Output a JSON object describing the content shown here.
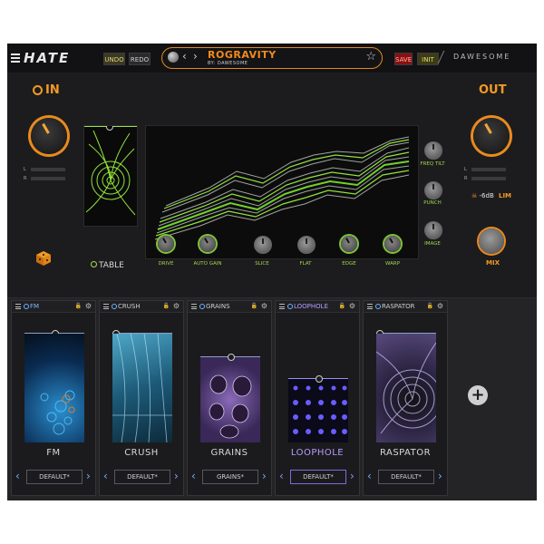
{
  "header": {
    "logo": "HATE",
    "undo": "UNDO",
    "redo": "REDO",
    "preset_name": "ROGRAVITY",
    "preset_author": "BY: DAWESOME",
    "save": "SAVE",
    "init": "INIT",
    "brand": "DAWESOME"
  },
  "input": {
    "label": "IN",
    "meter_l": "L",
    "meter_r": "R"
  },
  "output": {
    "label": "OUT",
    "meter_l": "L",
    "meter_r": "R",
    "limiter_value": "-6dB",
    "limiter_label": "LIM",
    "mix_label": "MIX"
  },
  "table": {
    "label": "TABLE"
  },
  "right_knobs": [
    "FREQ TILT",
    "PUNCH",
    "IMAGE"
  ],
  "bottom_knobs": [
    "DRIVE",
    "AUTO GAIN",
    "SLICE",
    "FLAT",
    "EDGE",
    "WARP"
  ],
  "modules": [
    {
      "name": "FM",
      "title": "FM",
      "preset": "DEFAULT*"
    },
    {
      "name": "CRUSH",
      "title": "CRUSH",
      "preset": "DEFAULT*"
    },
    {
      "name": "GRAINS",
      "title": "GRAINS",
      "preset": "GRAINS*"
    },
    {
      "name": "LOOPHOLE",
      "title": "LOOPHOLE",
      "preset": "DEFAULT*"
    },
    {
      "name": "RASPATOR",
      "title": "RASPATOR",
      "preset": "DEFAULT*"
    }
  ],
  "add_module": "+",
  "colors": {
    "accent_orange": "#f29a24",
    "accent_green": "#9fd64a",
    "accent_blue": "#6ab4ff",
    "save_red": "#8a1010"
  }
}
